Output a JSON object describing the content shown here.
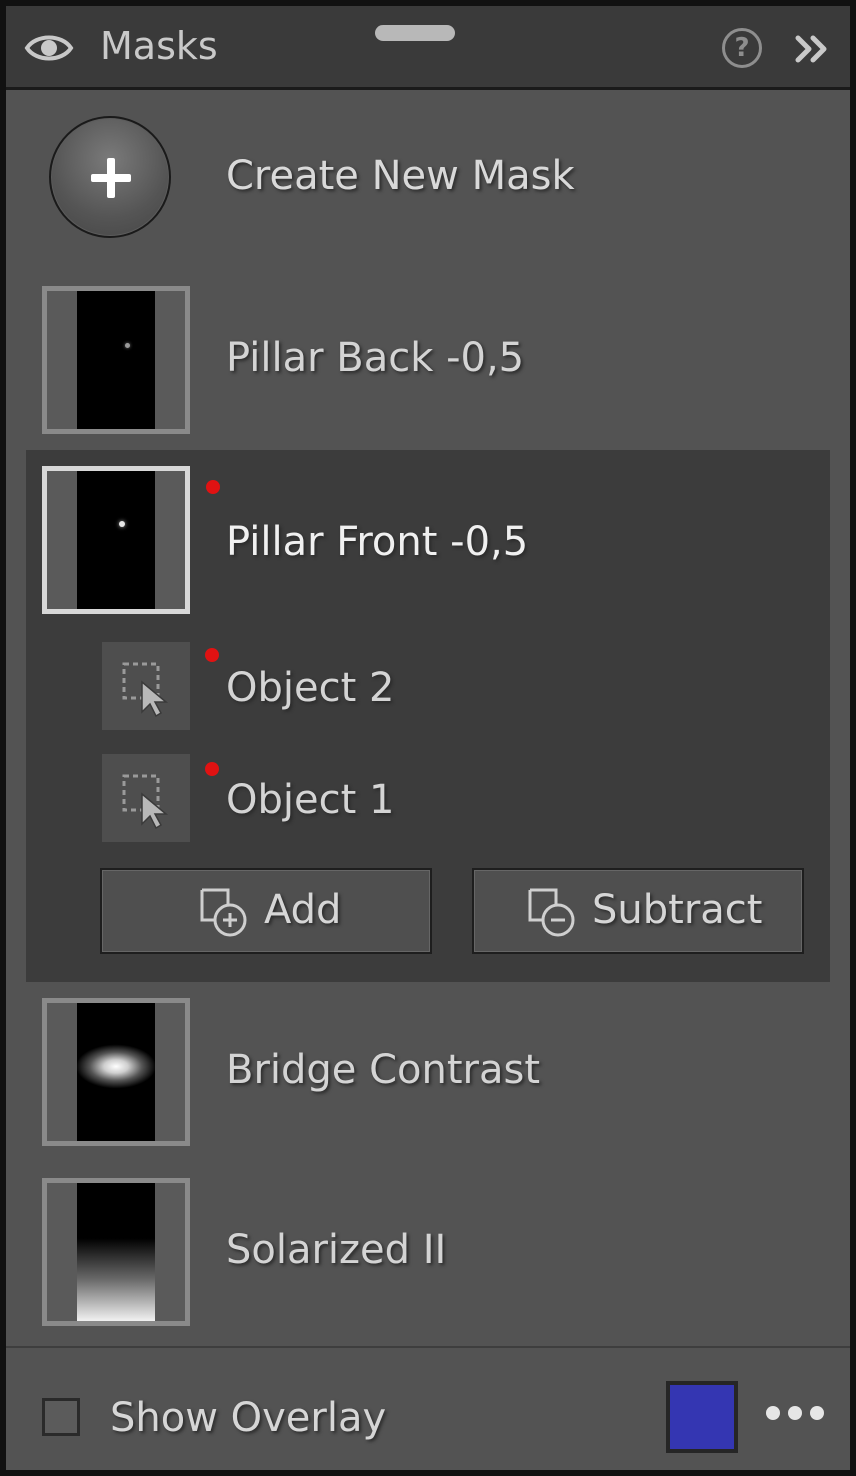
{
  "header": {
    "title": "Masks",
    "eye_icon": "eye-icon",
    "help_icon": "help-circle-icon",
    "help_glyph": "?",
    "collapse_icon": "double-chevron-right-icon"
  },
  "create": {
    "label": "Create New Mask",
    "icon": "plus-icon"
  },
  "masks": [
    {
      "name": "Pillar Back -0,5",
      "selected": false,
      "modified": false
    },
    {
      "name": "Pillar Front -0,5",
      "selected": true,
      "modified": true,
      "components": [
        {
          "name": "Object 2",
          "icon": "object-select-icon",
          "modified": true
        },
        {
          "name": "Object 1",
          "icon": "object-select-icon",
          "modified": true
        }
      ],
      "actions": {
        "add_label": "Add",
        "subtract_label": "Subtract"
      }
    },
    {
      "name": "Bridge Contrast",
      "selected": false,
      "modified": false
    },
    {
      "name": "Solarized II",
      "selected": false,
      "modified": false
    }
  ],
  "footer": {
    "show_overlay_label": "Show Overlay",
    "show_overlay_checked": false,
    "overlay_color": "#3436b2",
    "more_icon": "more-horizontal-icon"
  },
  "colors": {
    "modified_dot": "#e01212",
    "panel_bg": "#535353",
    "selected_group_bg": "#3c3c3c"
  }
}
